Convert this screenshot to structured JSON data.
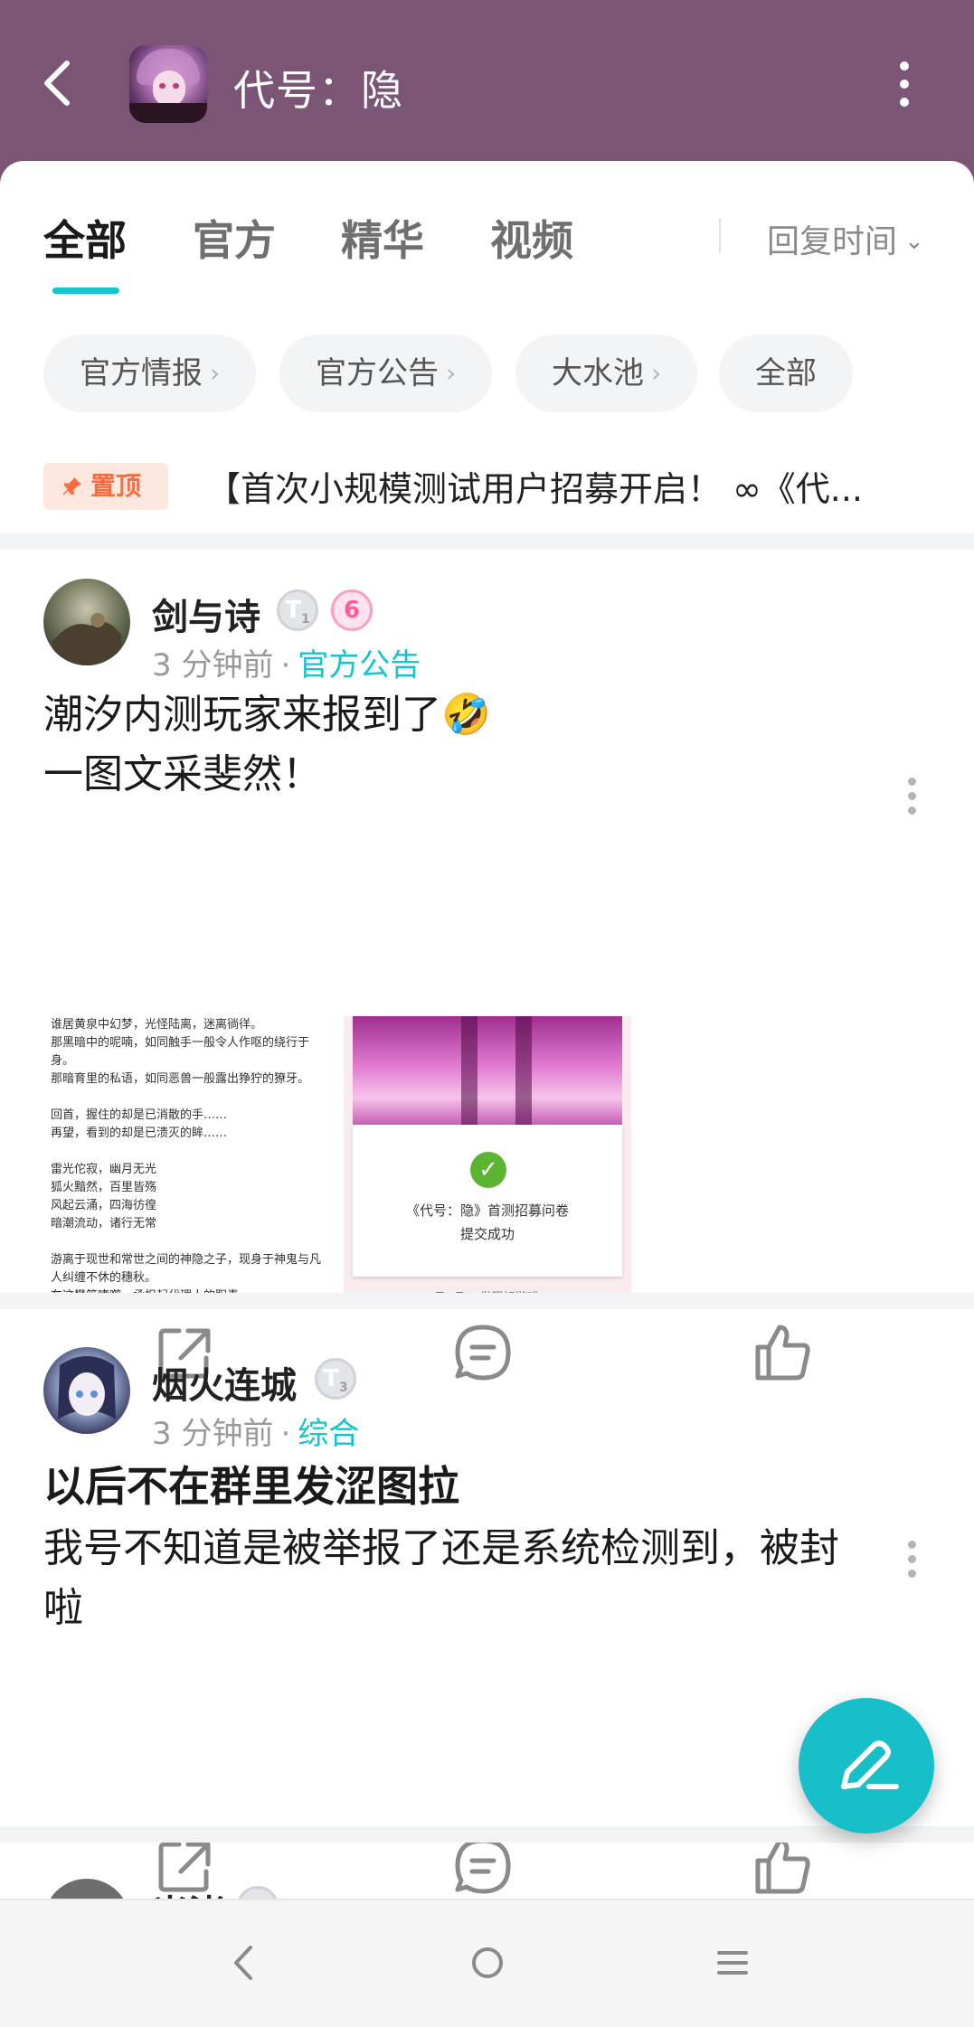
{
  "header": {
    "title": "代号：隐",
    "icons": {
      "back": "back-arrow-icon",
      "more": "more-vertical-icon",
      "app": "game-app-icon"
    }
  },
  "tabs": [
    {
      "label": "全部",
      "active": true
    },
    {
      "label": "官方",
      "active": false
    },
    {
      "label": "精华",
      "active": false
    },
    {
      "label": "视频",
      "active": false
    }
  ],
  "sort": {
    "label": "回复时间"
  },
  "chips": [
    {
      "label": "官方情报",
      "arrow": "›"
    },
    {
      "label": "官方公告",
      "arrow": "›"
    },
    {
      "label": "大水池",
      "arrow": "›"
    },
    {
      "label": "全部",
      "arrow": ""
    }
  ],
  "pinned": {
    "badge": "置顶",
    "text": "【首次小规模测试用户招募开启！ ∞《代..."
  },
  "posts": [
    {
      "username": "剑与诗",
      "badge_level": "T",
      "badge_level_num": "1",
      "badge_extra": "6",
      "time": "3 分钟前",
      "dot": "·",
      "category": "官方公告",
      "text_line1": "潮汐内测玩家来报到了🤣",
      "text_line2": "一图文采斐然！",
      "thumb1_lines": [
        "谁居黄泉中幻梦，光怪陆离，迷离徜徉。",
        "那黑暗中的呢喃，如同触手一般令人作呕的绕行于",
        "身。",
        "那暗育里的私语，如同恶兽一般露出狰狞的獠牙。",
        "",
        "回首，握住的却是已消散的手……",
        "再望，看到的却是已溃灭的眸……",
        "",
        "雷光佗寂，幽月无光",
        "狐火黯然，百里皆殇",
        "风起云涌，四海彷徨",
        "暗潮流动，诸行无常",
        "",
        "游离于现世和常世之间的神隐之子，现身于神鬼与凡",
        "人纠缠不休的穗秋。",
        "在这樊笼嗜噬，承担起代理人的职责。"
      ],
      "thumb2_title": "《代号：隐》首测招募问卷",
      "thumb2_sub": "提交成功",
      "thumb2_foot": "TapTap 发现好游戏"
    },
    {
      "username": "烟火连城",
      "badge_level": "T",
      "badge_level_num": "3",
      "time": "3 分钟前",
      "dot": "·",
      "category": "综合",
      "title": "以后不在群里发涩图拉",
      "text_line1": "我号不知道是被举报了还是系统检测到，被封",
      "text_line2": "啦"
    },
    {
      "username": "米渚"
    }
  ],
  "actions": {
    "share": "share-icon",
    "comment": "comment-icon",
    "like": "thumbs-up-icon"
  },
  "fab": {
    "icon": "compose-pen-icon"
  },
  "navbar": {
    "back": "nav-back-icon",
    "home": "nav-home-icon",
    "menu": "nav-menu-icon"
  },
  "colors": {
    "header": "#7a5576",
    "accent": "#15c5ce",
    "pin": "#ff6a3d"
  }
}
